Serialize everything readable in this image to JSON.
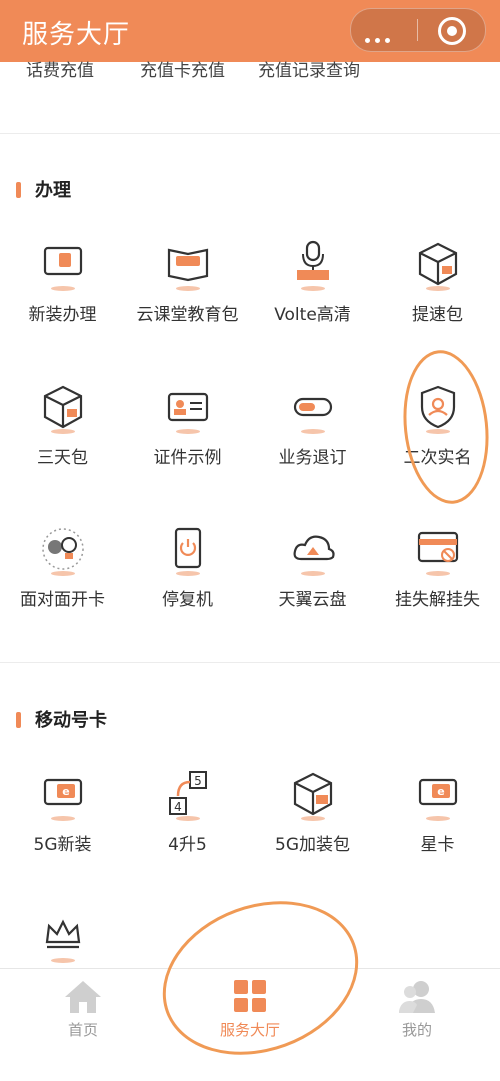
{
  "header": {
    "title": "服务大厅",
    "more_icon": "more-dots-icon",
    "close_icon": "target-icon"
  },
  "top_links": [
    "话费充值",
    "充值卡充值",
    "充值记录查询"
  ],
  "sections": [
    {
      "title": "办理",
      "items": [
        {
          "label": "新装办理",
          "icon": "sim-card-icon"
        },
        {
          "label": "云课堂教育包",
          "icon": "edu-book-icon"
        },
        {
          "label": "Volte高清",
          "icon": "volte-mic-icon"
        },
        {
          "label": "提速包",
          "icon": "speed-box-icon"
        },
        {
          "label": "三天包",
          "icon": "three-day-box-icon"
        },
        {
          "label": "证件示例",
          "icon": "id-card-icon"
        },
        {
          "label": "业务退订",
          "icon": "toggle-icon"
        },
        {
          "label": "二次实名",
          "icon": "shield-user-icon"
        },
        {
          "label": "面对面开卡",
          "icon": "face-to-face-icon"
        },
        {
          "label": "停复机",
          "icon": "power-phone-icon"
        },
        {
          "label": "天翼云盘",
          "icon": "cloud-upload-icon"
        },
        {
          "label": "挂失解挂失",
          "icon": "card-block-icon"
        }
      ]
    },
    {
      "title": "移动号卡",
      "items": [
        {
          "label": "5G新装",
          "icon": "5g-sim-icon"
        },
        {
          "label": "4升5",
          "icon": "4-to-5-icon"
        },
        {
          "label": "5G加装包",
          "icon": "5g-box-icon"
        },
        {
          "label": "星卡",
          "icon": "star-card-icon"
        },
        {
          "label": "",
          "icon": "crown-icon"
        }
      ]
    }
  ],
  "tabbar": [
    {
      "label": "首页",
      "icon": "home-icon",
      "active": false
    },
    {
      "label": "服务大厅",
      "icon": "grid-icon",
      "active": true
    },
    {
      "label": "我的",
      "icon": "user-icon",
      "active": false
    }
  ],
  "colors": {
    "brand": "#f08a57",
    "icon_outline": "#333333",
    "shadow": "#f6c5ab"
  }
}
